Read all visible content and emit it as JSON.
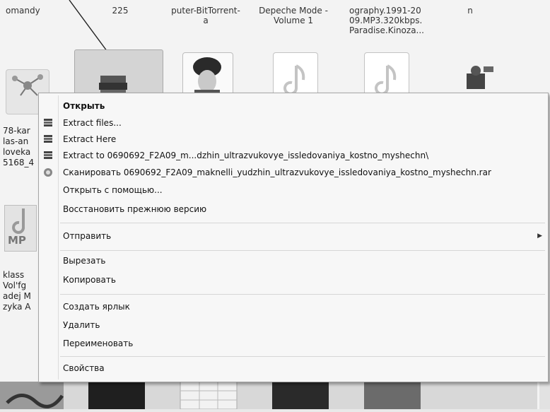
{
  "files_top": [
    {
      "name": "omandy"
    },
    {
      "name": "225"
    },
    {
      "name": "puter-BitTorrent-\na"
    },
    {
      "name": "Depeche Mode -\nVolume 1"
    },
    {
      "name": "ography.1991-20\n09.MP3.320kbps.\nParadise.Kinoza..."
    },
    {
      "name": "n"
    }
  ],
  "left_files": {
    "block1": "78-kar\nlas-an\nloveka\n5168_4",
    "block2": "klass\nVol'fg\nadej M\nzyka A",
    "mp3_label": "MP"
  },
  "menu": {
    "open": "Открыть",
    "extract_files": "Extract files...",
    "extract_here": "Extract Here",
    "extract_to": "Extract to 0690692_F2A09_m...dzhin_ultrazvukovye_issledovaniya_kostno_myshechn\\",
    "scan": "Сканировать 0690692_F2A09_maknelli_yudzhin_ultrazvukovye_issledovaniya_kostno_myshechn.rar",
    "open_with": "Открыть с помощью...",
    "restore": "Восстановить прежнюю версию",
    "send_to": "Отправить",
    "cut": "Вырезать",
    "copy": "Копировать",
    "create_shortcut": "Создать ярлык",
    "delete": "Удалить",
    "rename": "Переименовать",
    "properties": "Свойства"
  },
  "icons": {
    "winrar": "winrar-archive-icon",
    "scan": "antivirus-scan-icon",
    "submenu": "chevron-right-icon"
  }
}
